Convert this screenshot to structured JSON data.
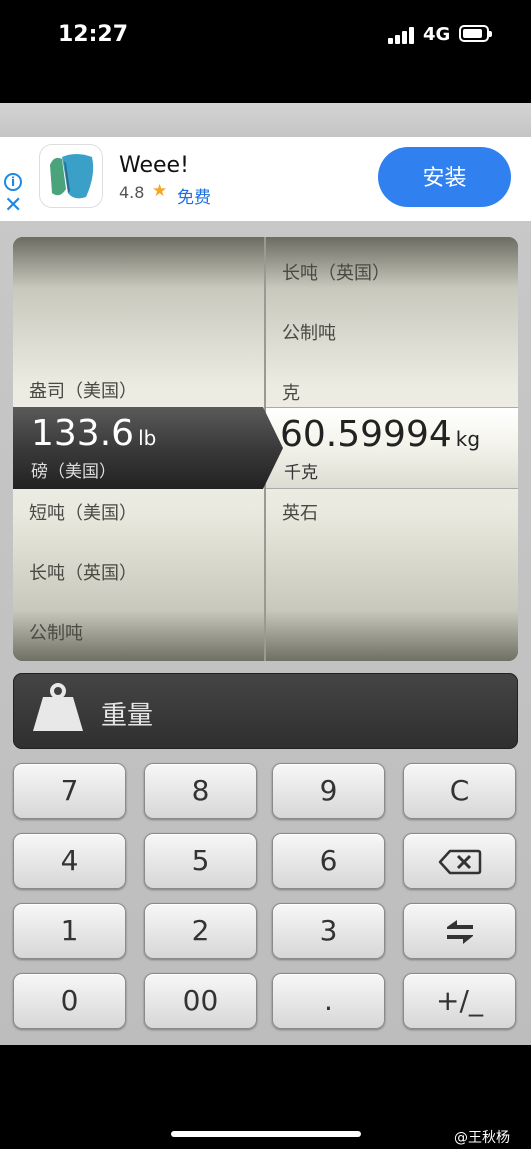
{
  "status_bar": {
    "time": "12:27",
    "network": "4G"
  },
  "ad": {
    "app_name": "Weee!",
    "rating": "4.8",
    "star": "★",
    "price": "免费",
    "install_label": "安装",
    "close_glyph": "✕",
    "info_glyph": "i"
  },
  "converter": {
    "left_wheel": {
      "items_above": [
        "盎司（美国）"
      ],
      "selected": {
        "value": "133.6",
        "unit": "lb",
        "name": "磅（美国）"
      },
      "items_below": [
        "短吨（美国）",
        "长吨（英国）",
        "公制吨"
      ]
    },
    "right_wheel": {
      "items_above": [
        "长吨（英国）",
        "公制吨",
        "克"
      ],
      "selected": {
        "value": "60.59994",
        "unit": "kg",
        "name": "千克"
      },
      "items_below": [
        "英石"
      ]
    }
  },
  "category": {
    "label": "重量",
    "icon": "weight-icon"
  },
  "keypad": {
    "rows": [
      [
        "7",
        "8",
        "9",
        "C"
      ],
      [
        "4",
        "5",
        "6",
        "backspace-icon"
      ],
      [
        "1",
        "2",
        "3",
        "swap-icon"
      ],
      [
        "0",
        "00",
        ".",
        "+/_"
      ]
    ]
  },
  "watermark": "@王秋杨"
}
